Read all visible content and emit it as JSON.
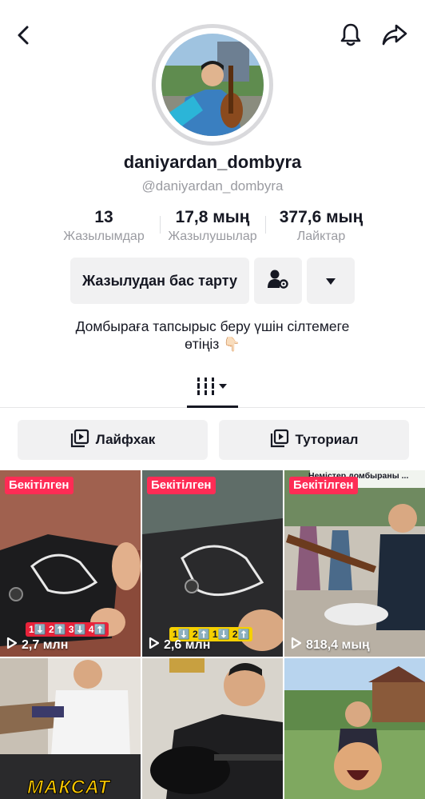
{
  "profile": {
    "username": "daniyardan_dombyra",
    "handle": "@daniyardan_dombyra",
    "stats": [
      {
        "value": "13",
        "label": "Жазылымдар"
      },
      {
        "value": "17,8 мың",
        "label": "Жазылушылар"
      },
      {
        "value": "377,6 мың",
        "label": "Лайктар"
      }
    ],
    "bio_line1": "Домбыраға тапсырыс беру үшін сілтемеге",
    "bio_line2": "өтіңіз 👇🏻"
  },
  "actions": {
    "unfollow_label": "Жазылудан бас тарту"
  },
  "playlists": [
    {
      "label": "Лайфхак"
    },
    {
      "label": "Туториал"
    }
  ],
  "videos": [
    {
      "pinned": "Бекітілген",
      "views": "2,7 млн",
      "overlay": "1⬇️ 2⬆️ 3⬇️ 4⬆️"
    },
    {
      "pinned": "Бекітілген",
      "views": "2,6 млн",
      "overlay": "1⬇️ 2⬆️ 1⬇️ 2⬆️"
    },
    {
      "pinned": "Бекітілген",
      "views": "818,4 мың",
      "overlay": "Немістер домбыраны ... іпті😍🔥"
    },
    {
      "overlay": "МАКСАТ"
    },
    {},
    {}
  ],
  "colors": {
    "accent": "#fe2c55",
    "text": "#161823",
    "muted": "#9a9ba1",
    "button_bg": "#f1f1f2"
  }
}
